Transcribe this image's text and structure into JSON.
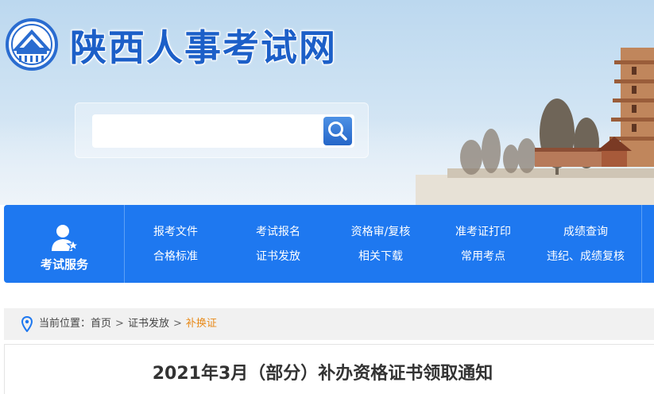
{
  "header": {
    "site_title": "陕西人事考试网",
    "logo_icon": "pagoda-emblem-icon",
    "brand_color": "#1c5fc8"
  },
  "search": {
    "placeholder": "",
    "value": "",
    "button_icon": "search-icon"
  },
  "nav": {
    "service_label": "考试服务",
    "service_icon": "user-star-icon",
    "bg_color": "#1e78f0",
    "links_row1": [
      "报考文件",
      "考试报名",
      "资格审/复核",
      "准考证打印",
      "成绩查询"
    ],
    "links_row2": [
      "合格标准",
      "证书发放",
      "相关下载",
      "常用考点",
      "违纪、成绩复核"
    ]
  },
  "breadcrumb": {
    "label": "当前位置：",
    "items": [
      "首页",
      "证书发放"
    ],
    "current": "补换证",
    "separator": ">",
    "current_color": "#e88a1a"
  },
  "article": {
    "title": "2021年3月（部分）补办资格证书领取通知"
  }
}
